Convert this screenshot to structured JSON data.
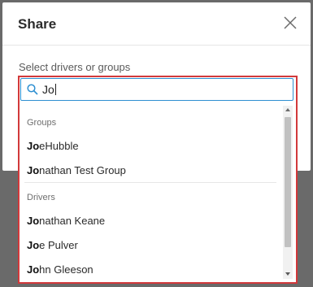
{
  "modal": {
    "title": "Share",
    "field_label": "Select drivers or groups"
  },
  "search": {
    "value": "Jo"
  },
  "dropdown": {
    "groups_label": "Groups",
    "groups": [
      {
        "match": "Jo",
        "rest": "eHubble"
      },
      {
        "match": "Jo",
        "rest": "nathan Test Group"
      }
    ],
    "drivers_label": "Drivers",
    "drivers": [
      {
        "match": "Jo",
        "rest": "nathan Keane"
      },
      {
        "match": "Jo",
        "rest": "e Pulver"
      },
      {
        "match": "Jo",
        "rest": "hn Gleeson"
      }
    ]
  },
  "colors": {
    "highlight_border": "#d2393b",
    "focus_border": "#2e8fd1"
  },
  "icons": {
    "close": "close-icon",
    "search": "search-icon"
  }
}
